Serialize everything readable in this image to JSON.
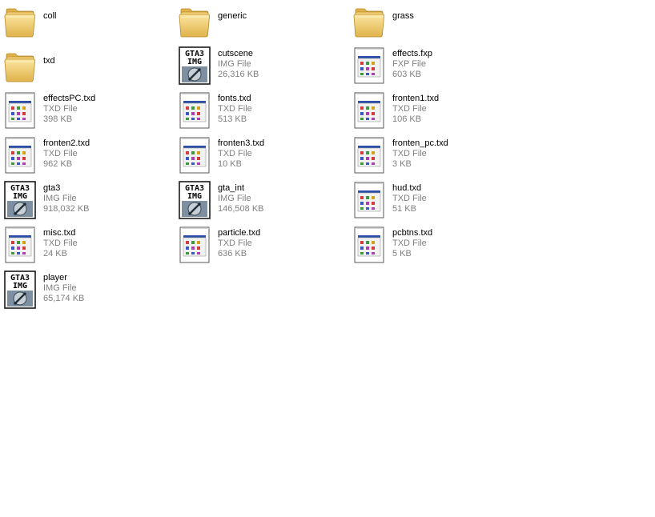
{
  "files": [
    {
      "name": "coll",
      "kind": "folder",
      "type": "",
      "size": ""
    },
    {
      "name": "generic",
      "kind": "folder",
      "type": "",
      "size": ""
    },
    {
      "name": "grass",
      "kind": "folder",
      "type": "",
      "size": ""
    },
    {
      "name": "txd",
      "kind": "folder",
      "type": "",
      "size": ""
    },
    {
      "name": "cutscene",
      "kind": "img",
      "type": "IMG File",
      "size": "26,316 KB"
    },
    {
      "name": "effects.fxp",
      "kind": "txd",
      "type": "FXP File",
      "size": "603 KB"
    },
    {
      "name": "effectsPC.txd",
      "kind": "txd",
      "type": "TXD File",
      "size": "398 KB"
    },
    {
      "name": "fonts.txd",
      "kind": "txd",
      "type": "TXD File",
      "size": "513 KB"
    },
    {
      "name": "fronten1.txd",
      "kind": "txd",
      "type": "TXD File",
      "size": "106 KB"
    },
    {
      "name": "fronten2.txd",
      "kind": "txd",
      "type": "TXD File",
      "size": "962 KB"
    },
    {
      "name": "fronten3.txd",
      "kind": "txd",
      "type": "TXD File",
      "size": "10 KB"
    },
    {
      "name": "fronten_pc.txd",
      "kind": "txd",
      "type": "TXD File",
      "size": "3 KB"
    },
    {
      "name": "gta3",
      "kind": "img",
      "type": "IMG File",
      "size": "918,032 KB"
    },
    {
      "name": "gta_int",
      "kind": "img",
      "type": "IMG File",
      "size": "146,508 KB"
    },
    {
      "name": "hud.txd",
      "kind": "txd",
      "type": "TXD File",
      "size": "51 KB"
    },
    {
      "name": "misc.txd",
      "kind": "txd",
      "type": "TXD File",
      "size": "24 KB"
    },
    {
      "name": "particle.txd",
      "kind": "txd",
      "type": "TXD File",
      "size": "636 KB"
    },
    {
      "name": "pcbtns.txd",
      "kind": "txd",
      "type": "TXD File",
      "size": "5 KB"
    },
    {
      "name": "player",
      "kind": "img",
      "type": "IMG File",
      "size": "65,174 KB"
    }
  ],
  "icons": {
    "folder": "folder-icon",
    "img": "gta3-img-icon",
    "txd": "generic-document-icon"
  },
  "img_icon_text": [
    "GTA3",
    "IMG"
  ],
  "colors": {
    "folder_light": "#FBE7A1",
    "folder_dark": "#E0B24A",
    "doc_title_bar": "#2B4FA8"
  }
}
